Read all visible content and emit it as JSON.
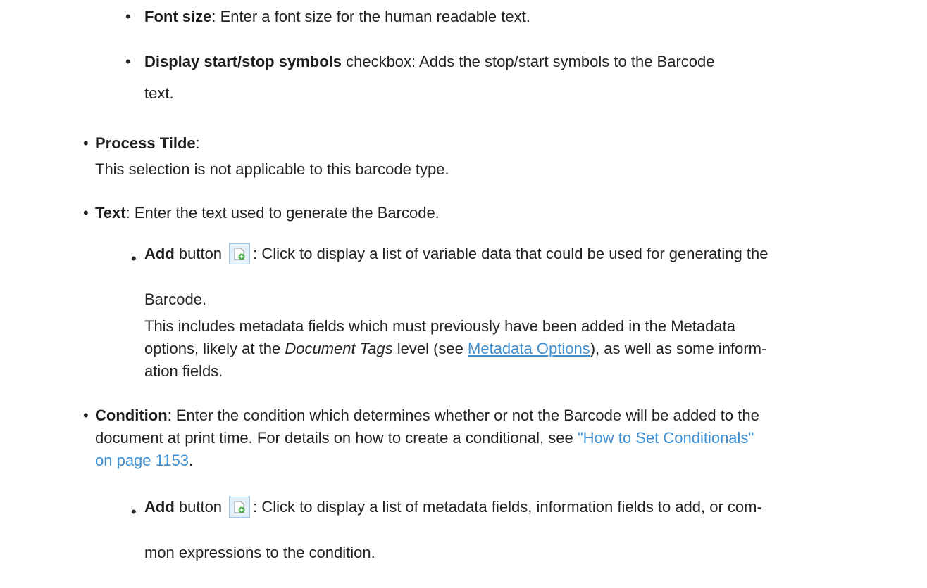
{
  "items": {
    "font_size": {
      "label": "Font size",
      "text": ": Enter a font size for the human readable text."
    },
    "display_start_stop": {
      "label": "Display start/stop symbols",
      "text_line1": " checkbox: Adds the stop/start symbols to the Barcode",
      "text_line2": "text."
    },
    "process_tilde": {
      "label": "Process Tilde",
      "colon": ":",
      "desc": "This selection is not applicable to this barcode type."
    },
    "text": {
      "label": "Text",
      "desc": ": Enter the text used to generate the Barcode.",
      "add": {
        "label": "Add",
        "word_button": " button ",
        "desc_line1": ": Click to display a list of variable data that could be used for generating the",
        "desc_line2": "Barcode.",
        "p2_line1": "This includes metadata fields which must previously have been added in the Metadata",
        "p2_line2_a": "options, likely at the ",
        "p2_line2_em": "Document Tags",
        "p2_line2_b": " level (see ",
        "p2_link": "Metadata Options",
        "p2_line2_c": "), as well as some inform-",
        "p2_line3": "ation fields."
      }
    },
    "condition": {
      "label": "Condition",
      "desc_line1": ": Enter the condition which determines whether or not the Barcode will be added to the",
      "desc_line2_a": "document at print time. For details on how to create a conditional, see ",
      "xref_line1": "\"How to Set Conditionals\"",
      "xref_line2": "on page 1153",
      "period": ".",
      "add": {
        "label": "Add",
        "word_button": " button ",
        "desc_line1": ": Click to display a list of metadata fields, information fields to add, or com-",
        "desc_line2": "mon expressions to the condition."
      }
    }
  },
  "bullet_glyph": "•",
  "icons": {
    "add": "add-data-icon"
  },
  "colors": {
    "link": "#3d8fd1",
    "text": "#222222",
    "icon_border": "#9ec7ea"
  }
}
